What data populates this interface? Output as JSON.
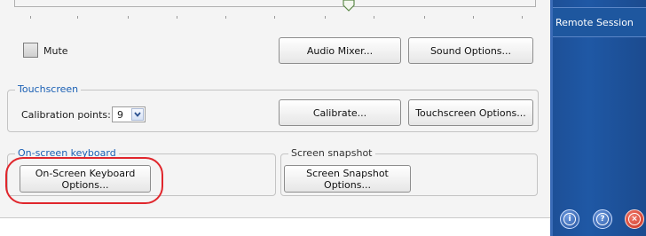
{
  "sound": {
    "mute_label": "Mute",
    "audio_mixer_button": "Audio Mixer...",
    "sound_options_button": "Sound Options..."
  },
  "touchscreen": {
    "group_title": "Touchscreen",
    "calibration_label": "Calibration points:",
    "calibration_value": "9",
    "calibrate_button": "Calibrate...",
    "options_button": "Touchscreen Options..."
  },
  "keyboard": {
    "group_title": "On-screen keyboard",
    "options_button_line1": "On-Screen Keyboard",
    "options_button_line2": "Options..."
  },
  "snapshot": {
    "group_title": "Screen snapshot",
    "options_button": "Screen Snapshot Options..."
  },
  "sidebar": {
    "item_label": "Remote Session",
    "info_glyph": "i",
    "help_glyph": "?",
    "close_glyph": "×"
  },
  "colors": {
    "highlight": "#e0262c",
    "sidebar": "#1f58a5",
    "group_title_blue": "#1a5fb4"
  }
}
